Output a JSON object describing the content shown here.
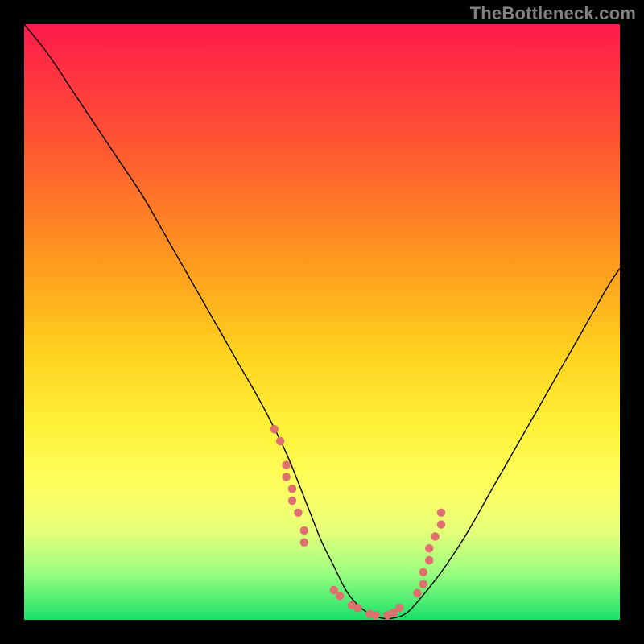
{
  "watermark": "TheBottleneck.com",
  "chart_data": {
    "type": "line",
    "title": "",
    "xlabel": "",
    "ylabel": "",
    "xlim": [
      0,
      100
    ],
    "ylim": [
      0,
      100
    ],
    "grid": false,
    "legend": false,
    "series": [
      {
        "name": "bottleneck-curve",
        "x": [
          0,
          4,
          8,
          12,
          16,
          20,
          24,
          28,
          32,
          36,
          40,
          44,
          48,
          50,
          52,
          54,
          56,
          58,
          60,
          62,
          64,
          66,
          70,
          74,
          78,
          82,
          86,
          90,
          94,
          98,
          100
        ],
        "y": [
          100,
          95,
          89,
          83,
          77,
          71,
          64,
          57,
          50,
          43,
          36,
          28,
          18,
          13,
          9,
          5,
          2.5,
          1,
          0.3,
          0.3,
          1,
          3,
          8,
          14,
          21,
          28,
          35,
          42,
          49,
          56,
          59
        ]
      }
    ],
    "highlighted_points": {
      "name": "scatter-cluster",
      "note": "Pink scatter points near curve minimum (approximate coordinates)",
      "points": [
        [
          42,
          32
        ],
        [
          43,
          30
        ],
        [
          44,
          26
        ],
        [
          44,
          24
        ],
        [
          45,
          22
        ],
        [
          45,
          20
        ],
        [
          46,
          18
        ],
        [
          47,
          15
        ],
        [
          47,
          13
        ],
        [
          52,
          5
        ],
        [
          53,
          4
        ],
        [
          55,
          2.5
        ],
        [
          56,
          2
        ],
        [
          58,
          1
        ],
        [
          59,
          0.8
        ],
        [
          61,
          0.8
        ],
        [
          62,
          1.2
        ],
        [
          63,
          2
        ],
        [
          66,
          4.5
        ],
        [
          67,
          6
        ],
        [
          67,
          8
        ],
        [
          68,
          10
        ],
        [
          68,
          12
        ],
        [
          69,
          14
        ],
        [
          70,
          16
        ],
        [
          70,
          18
        ]
      ]
    },
    "colors": {
      "gradient_top": "#ff1a4b",
      "gradient_mid": "#fff23a",
      "gradient_bottom": "#19e06a",
      "curve": "#000000",
      "dots": "#e07070",
      "frame": "#000000"
    }
  }
}
